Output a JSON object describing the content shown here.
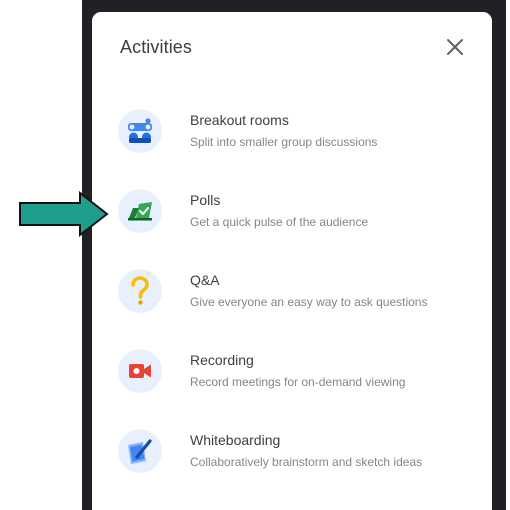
{
  "panel": {
    "title": "Activities",
    "close_label": "Close"
  },
  "activities": [
    {
      "title": "Breakout rooms",
      "description": "Split into smaller group discussions",
      "icon": "breakout-rooms-icon"
    },
    {
      "title": "Polls",
      "description": "Get a quick pulse of the audience",
      "icon": "polls-icon"
    },
    {
      "title": "Q&A",
      "description": "Give everyone an easy way to ask questions",
      "icon": "qa-icon"
    },
    {
      "title": "Recording",
      "description": "Record meetings for on-demand viewing",
      "icon": "recording-icon"
    },
    {
      "title": "Whiteboarding",
      "description": "Collaboratively brainstorm and sketch ideas",
      "icon": "whiteboard-icon"
    }
  ],
  "colors": {
    "arrow": "#1f9e8c",
    "backdrop": "#202124",
    "icon_background": "#e8f0fe",
    "blue": "#4285f4",
    "green": "#1e8e3e",
    "yellow": "#fbbc04",
    "red": "#ea4335"
  }
}
